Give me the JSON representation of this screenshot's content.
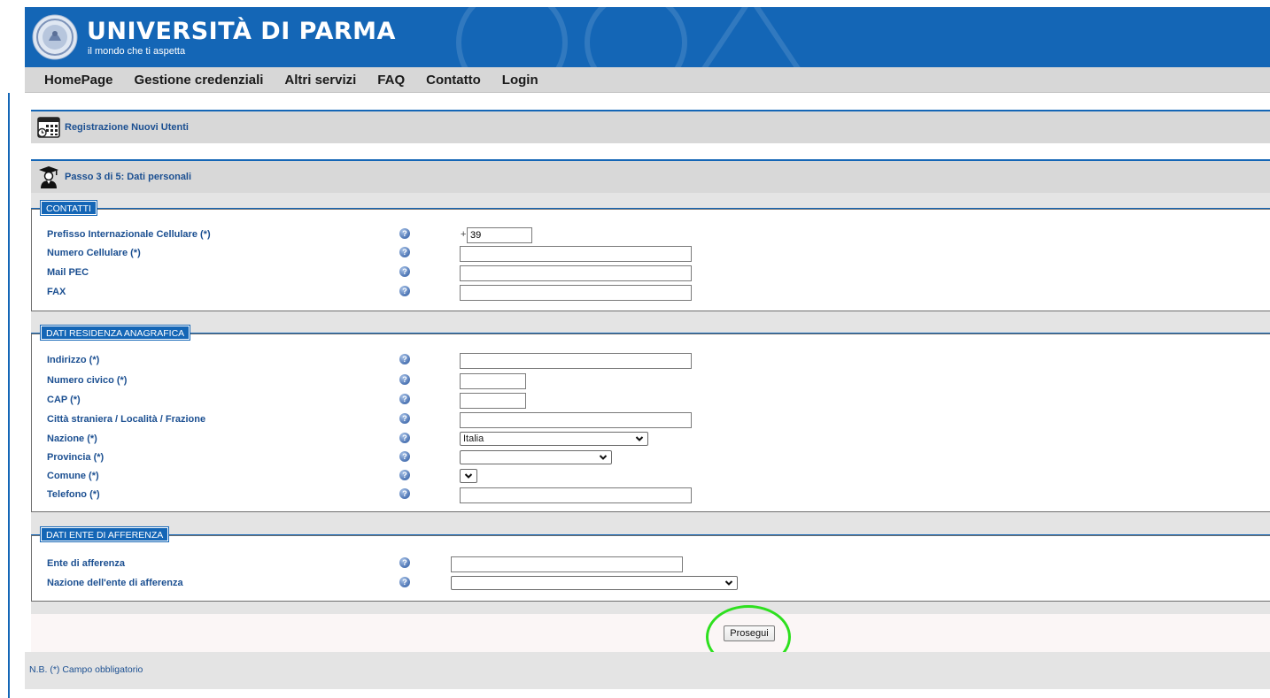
{
  "header": {
    "title": "UNIVERSITÀ DI PARMA",
    "tagline": "il mondo che ti aspetta",
    "seal_icon": "university-seal-icon",
    "color": "#1466b6"
  },
  "nav": {
    "items": [
      "HomePage",
      "Gestione credenziali",
      "Altri servizi",
      "FAQ",
      "Contatto",
      "Login"
    ]
  },
  "page": {
    "section_title": "Registrazione Nuovi Utenti",
    "step_title": "Passo 3 di 5: Dati personali"
  },
  "contatti": {
    "legend": "CONTATTI",
    "fields": [
      {
        "label": "Prefisso Internazionale Cellulare (*)",
        "prefix": "+",
        "value": "39"
      },
      {
        "label": "Numero Cellulare (*)",
        "value": ""
      },
      {
        "label": "Mail PEC",
        "value": ""
      },
      {
        "label": "FAX",
        "value": ""
      }
    ]
  },
  "residenza": {
    "legend": "DATI RESIDENZA ANAGRAFICA",
    "fields": [
      {
        "label": "Indirizzo (*)",
        "value": ""
      },
      {
        "label": "Numero civico (*)",
        "value": ""
      },
      {
        "label": "CAP (*)",
        "value": ""
      },
      {
        "label": "Città straniera / Località / Frazione",
        "value": ""
      },
      {
        "label": "Nazione (*)",
        "value": "Italia"
      },
      {
        "label": "Provincia (*)",
        "value": ""
      },
      {
        "label": "Comune (*)",
        "value": ""
      },
      {
        "label": "Telefono (*)",
        "value": ""
      }
    ]
  },
  "ente": {
    "legend": "DATI ENTE DI AFFERENZA",
    "fields": [
      {
        "label": "Ente di afferenza",
        "value": ""
      },
      {
        "label": "Nazione dell'ente di afferenza",
        "value": ""
      }
    ]
  },
  "actions": {
    "submit_label": "Prosegui",
    "highlight_color": "#2ee01f"
  },
  "footer": {
    "note": "N.B. (*) Campo obbligatorio"
  }
}
